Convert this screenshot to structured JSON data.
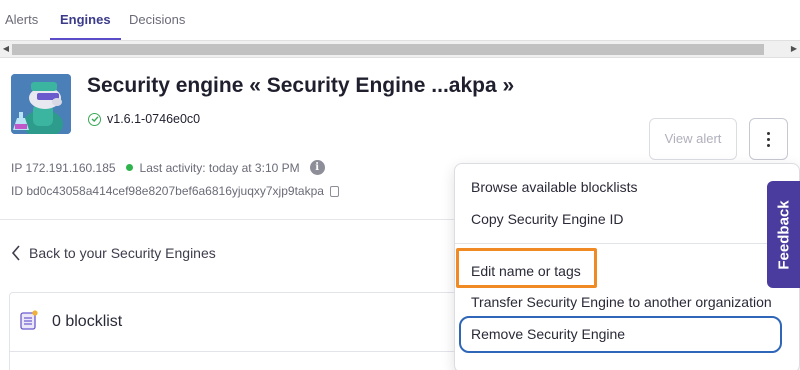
{
  "tabs": [
    {
      "label": "Alerts",
      "active": false
    },
    {
      "label": "Engines",
      "active": true
    },
    {
      "label": "Decisions",
      "active": false
    }
  ],
  "header": {
    "title": "Security engine « Security Engine ...akpa »",
    "version": "v1.6.1-0746e0c0",
    "ip": "IP 172.191.160.185",
    "last_activity": "Last activity: today at 3:10 PM",
    "engine_id": "ID bd0c43058a414cef98e8207bef6a6816yjuqxy7xjp9takpa",
    "view_alert_label": "View alert"
  },
  "back_link": "Back to your Security Engines",
  "card": {
    "blocklist_label": "0 blocklist"
  },
  "menu": {
    "items": [
      "Browse available blocklists",
      "Copy Security Engine ID",
      "Edit name or tags",
      "Transfer Security Engine to another organization",
      "Remove Security Engine"
    ]
  },
  "feedback_label": "Feedback",
  "colors": {
    "accent": "#5b4dc7",
    "status_green": "#2fb34c",
    "highlight_orange": "#f08a24",
    "focus_blue": "#2f66b8",
    "feedback_bg": "#4a3c9e"
  }
}
